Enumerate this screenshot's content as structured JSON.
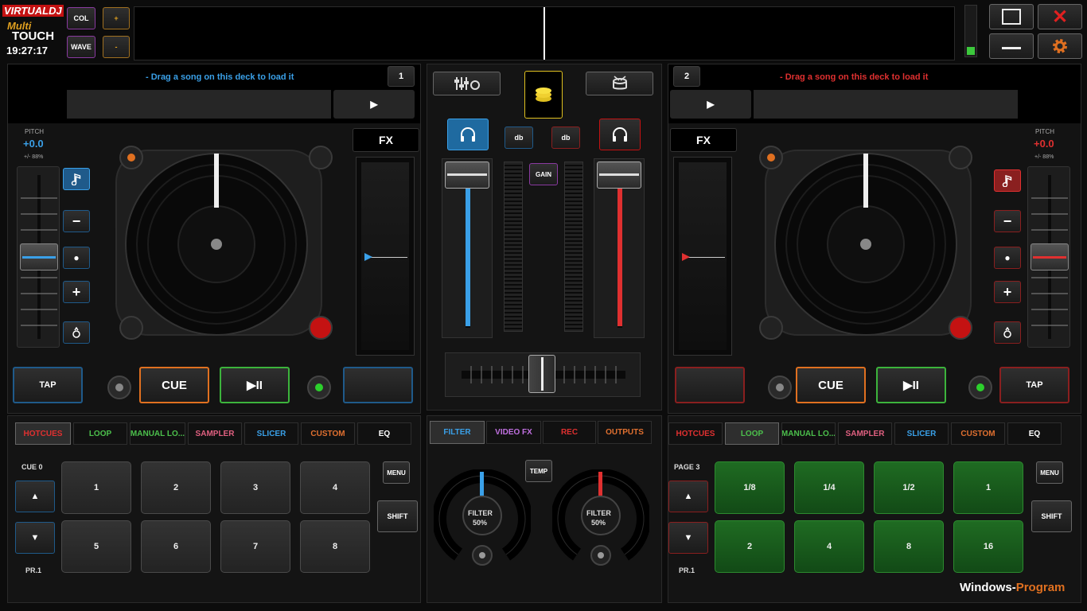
{
  "header": {
    "logo_virtual": "VIRTUALDJ",
    "logo_multi": "Multi",
    "logo_touch": "TOUCH",
    "clock": "19:27:17",
    "col_label": "COL",
    "wave_label": "WAVE",
    "plus_label": "+",
    "minus_label": "-"
  },
  "window_controls": {
    "maximize_icon": "square-icon",
    "close_glyph": "✕",
    "minimize_icon": "minimize-icon",
    "settings_icon": "gear-icon"
  },
  "deck_left": {
    "number": "1",
    "load_hint": "- Drag a song on this deck to load it",
    "play_glyph": "▶",
    "pitch_label": "PITCH",
    "pitch_value": "+0.0",
    "pitch_range": "+/- 88%",
    "fx_label": "FX",
    "tap_label": "TAP",
    "cue_label": "CUE",
    "playpause_glyph": "▶II",
    "minus": "−",
    "dot": "●",
    "plus": "+",
    "accent": "#3aa0e8"
  },
  "deck_right": {
    "number": "2",
    "load_hint": "- Drag a song on this deck to load it",
    "play_glyph": "▶",
    "pitch_label": "PITCH",
    "pitch_value": "+0.0",
    "pitch_range": "+/- 88%",
    "fx_label": "FX",
    "tap_label": "TAP",
    "cue_label": "CUE",
    "playpause_glyph": "▶II",
    "minus": "−",
    "dot": "●",
    "plus": "+",
    "accent": "#e03030"
  },
  "mixer": {
    "db_left": "db",
    "db_right": "db",
    "gain_label": "GAIN",
    "temp_label": "TEMP",
    "filter_label": "FILTER",
    "filter_left_value": "50%",
    "filter_right_value": "50%"
  },
  "tabs_left": {
    "items": [
      "HOTCUES",
      "LOOP",
      "MANUAL LO...",
      "SAMPLER",
      "SLICER",
      "CUSTOM",
      "EQ"
    ],
    "colors": [
      "#e03030",
      "#4cc04c",
      "#4cc04c",
      "#e06080",
      "#3aa0e8",
      "#e07030",
      "#ffffff"
    ]
  },
  "tabs_mixer": {
    "items": [
      "FILTER",
      "VIDEO FX",
      "REC",
      "OUTPUTS"
    ],
    "colors": [
      "#3aa0e8",
      "#c070e0",
      "#e03030",
      "#e07030"
    ]
  },
  "tabs_right": {
    "items": [
      "HOTCUES",
      "LOOP",
      "MANUAL LO...",
      "SAMPLER",
      "SLICER",
      "CUSTOM",
      "EQ"
    ],
    "colors": [
      "#e03030",
      "#4cc04c",
      "#4cc04c",
      "#e06080",
      "#3aa0e8",
      "#e07030",
      "#ffffff"
    ]
  },
  "pads_left": {
    "page_label": "CUE 0",
    "up": "▲",
    "down": "▼",
    "preset": "PR.1",
    "menu": "MENU",
    "shift": "SHIFT",
    "pads": [
      "1",
      "2",
      "3",
      "4",
      "5",
      "6",
      "7",
      "8"
    ]
  },
  "pads_right": {
    "page_label": "PAGE 3",
    "up": "▲",
    "down": "▼",
    "preset": "PR.1",
    "menu": "MENU",
    "shift": "SHIFT",
    "pads": [
      "1/8",
      "1/4",
      "1/2",
      "1",
      "2",
      "4",
      "8",
      "16"
    ]
  },
  "watermark": {
    "part1": "Windows-",
    "part2": "Program"
  }
}
